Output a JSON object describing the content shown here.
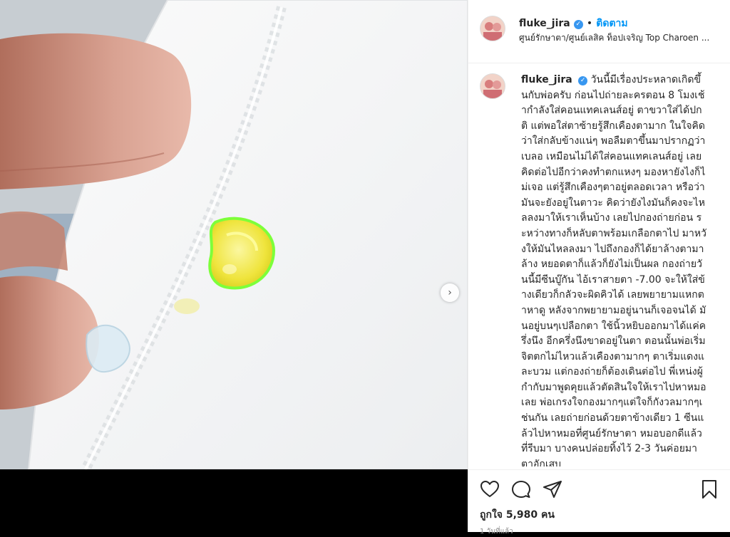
{
  "post": {
    "username": "fluke_jira",
    "verified_badge": "✓",
    "dot": "•",
    "follow_label": "ติดตาม",
    "location": "ศูนย์รักษาตา/ศูนย์เลสิค ท็อปเจริญ Top Charoen ..."
  },
  "caption": {
    "username": "fluke_jira",
    "text": "วันนี้มีเรื่องประหลาดเกิดขึ้นกับพ่อครับ ก่อนไปถ่ายละครตอน 8 โมงเช้ากำลังใส่คอนแทคเลนส์อยู่ ตาขวาใส่ได้ปกติ แต่พอใส่ตาซ้ายรู้สึกเคืองตามาก ในใจคิดว่าใส่กลับข้างแน่ๆ พอลืมตาขึ้นมาปรากฏว่าเบลอ เหมือนไม่ได้ใส่คอนแทคเลนส์อยู่ เลยคิดต่อไปอีกว่าคงทำตกแหงๆ มองหายังไงก็ไม่เจอ แต่รู้สึกเคืองๆตาอยู่ตลอดเวลา หรือว่ามันจะยังอยู่ในตาวะ คิดว่ายังไงมันก็คงจะไหลลงมาให้เราเห็นบ้าง เลยไปกองถ่ายก่อน ระหว่างทางก็หลับตาพร้อมเกลือกตาไป มาหวังให้มันไหลลงมา ไปถึงกองก็ได้ยาล้างตามาล้าง หยอดตาก็แล้วก็ยังไม่เป็นผล กองถ่ายวันนี้มีซีนบู๊กัน ไอ้เราสายตา -7.00 จะให้ใส่ข้างเดียวก็กลัวจะผิดคิวได้ เลยพยายามแหกตาหาดู หลังจากพยายามอยู่นานก็เจอจนได้ มันอยู่บนๆเปลือกตา ใช้นิ้วหยิบออกมาได้แค่ครึ่งนึง อีกครึ่งนึงขาดอยู่ในตา ตอนนั้นพ่อเริ่มจิตตกไม่ไหวแล้วเคืองตามากๆ ตาเริ่มแดงและบวม แต่กองถ่ายก็ต้องเดินต่อไป พี่เหน่งผู้กำกับมาพูดคุยแล้วตัดสินใจให้เราไปหาหมอเลย พ่อเกรงใจกองมากๆแต่ใจก็กังวลมากๆเช่นกัน เลยถ่ายก่อนด้วยตาข้างเดียว 1 ซีนแล้วไปหาหมอที่ศูนย์รักษาตา หมอบอกดีแล้วที่รีบมา บางคนปล่อยทิ้งไว้ 2-3 วันค่อยมา ตาอักเสบ"
  },
  "actions": {
    "like_icon": "heart-outline",
    "comment_icon": "comment-bubble",
    "share_icon": "paper-plane",
    "save_icon": "bookmark"
  },
  "likes_text": "ถูกใจ 5,980 คน",
  "time_text": "1 วันที่แล้ว",
  "carousel": {
    "next_glyph": "›"
  },
  "colors": {
    "accent": "#0095f6",
    "verified": "#3897f0",
    "lens": "#f4ec4a",
    "lens_rim": "#7dff3a"
  }
}
